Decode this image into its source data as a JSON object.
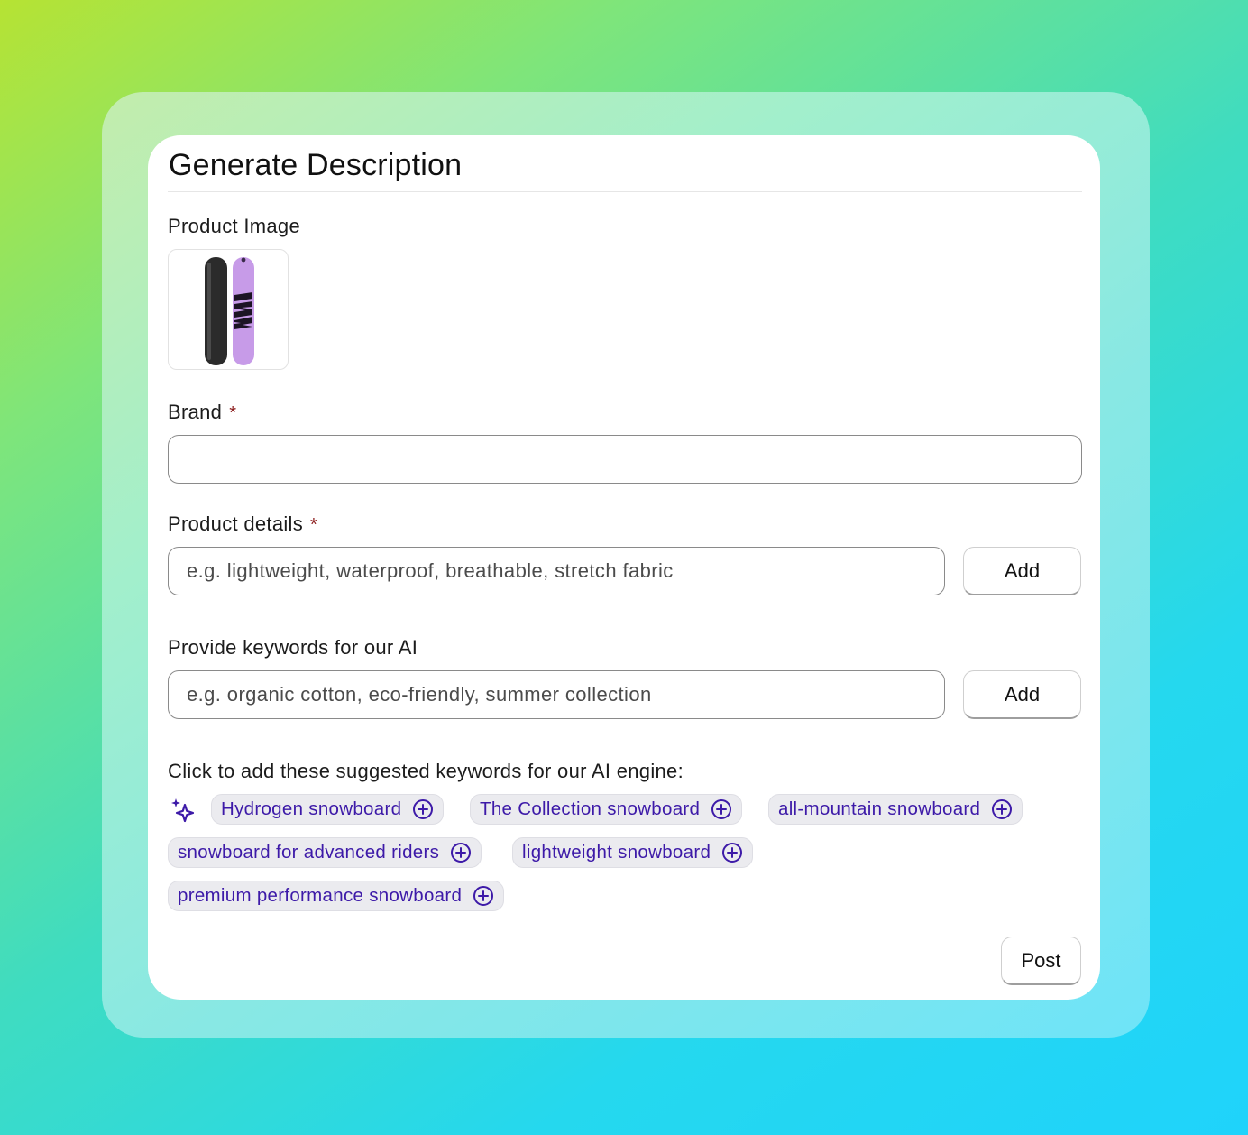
{
  "dialog": {
    "title": "Generate Description"
  },
  "product_image": {
    "label": "Product Image"
  },
  "brand": {
    "label": "Brand",
    "required_mark": "*",
    "value": ""
  },
  "product_details": {
    "label": "Product details",
    "required_mark": "*",
    "placeholder": "e.g. lightweight, waterproof, breathable, stretch fabric",
    "add_label": "Add"
  },
  "keywords": {
    "label": "Provide keywords for our AI",
    "placeholder": "e.g. organic cotton, eco-friendly, summer collection",
    "add_label": "Add"
  },
  "suggestions": {
    "intro": "Click to add these suggested keywords for our AI engine:",
    "icon": "sparkle-icon",
    "items": [
      "Hydrogen snowboard",
      "The Collection snowboard",
      "all-mountain snowboard",
      "snowboard for advanced riders",
      "lightweight snowboard",
      "premium performance snowboard"
    ],
    "chip_icon": "plus-circle-icon"
  },
  "footer": {
    "post_label": "Post"
  },
  "colors": {
    "chip_text": "#3d1aa8",
    "chip_bg": "#ebebef",
    "required": "#8b1a1a",
    "board_dark": "#2b2b2b",
    "board_purple": "#c79be8"
  }
}
